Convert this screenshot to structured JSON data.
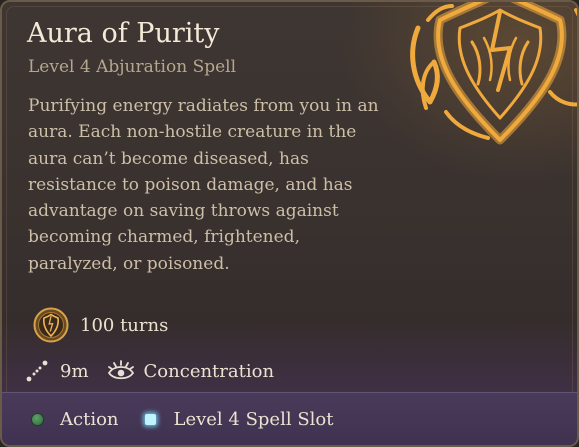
{
  "spell": {
    "title": "Aura of Purity",
    "subtitle": "Level 4 Abjuration Spell",
    "description": "Purifying energy radiates from you in an aura. Each non-hostile creature in the aura can’t become diseased, has resistance to poison damage, and has advantage on saving throws against becoming charmed, frightened, paralyzed, or poisoned."
  },
  "stats": {
    "duration": "100 turns",
    "range": "9m",
    "concentration": "Concentration"
  },
  "cost": {
    "action": "Action",
    "spell_slot": "Level 4 Spell Slot"
  },
  "icons": {
    "emblem": "abjuration-shield-emblem-icon",
    "duration": "turns-medallion-icon",
    "range": "range-icon",
    "concentration": "concentration-eye-icon",
    "action": "action-dot-icon",
    "spell_slot": "spell-slot-icon"
  },
  "colors": {
    "gold": "#f0a93c",
    "action_green": "#4e8c5a",
    "spell_slot_cyan": "#bff4ff",
    "footer_purple": "#433552"
  }
}
